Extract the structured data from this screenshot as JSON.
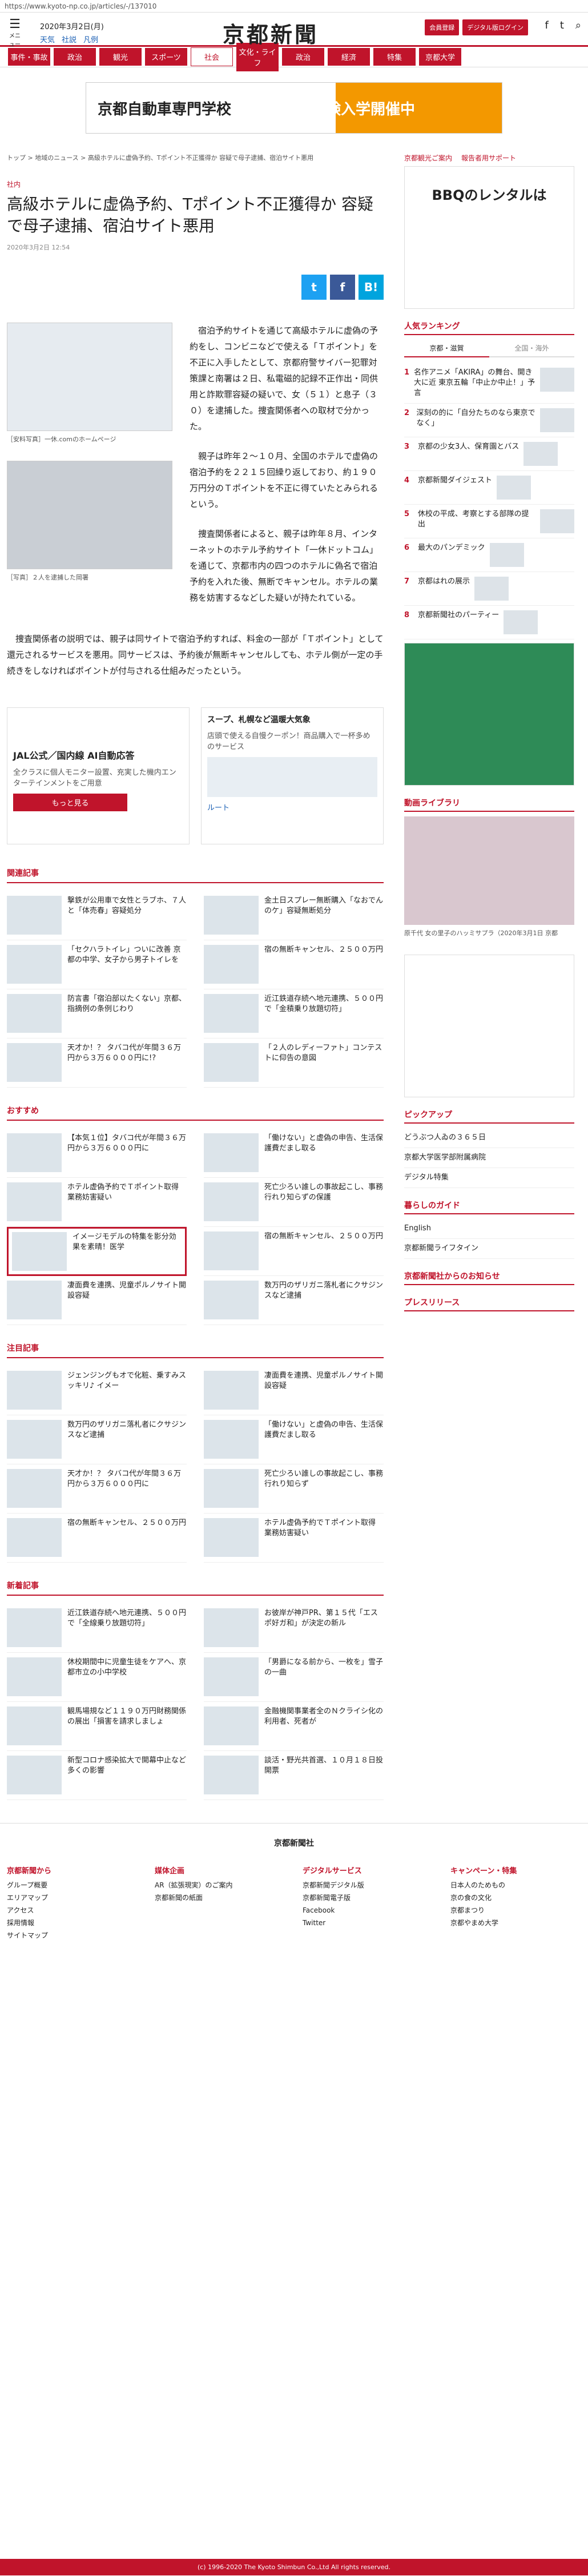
{
  "url": "https://www.kyoto-np.co.jp/articles/-/137010",
  "header": {
    "menu_label": "メニュー",
    "date": "2020年3月2日(月)",
    "weather": [
      "天気",
      "社説",
      "凡例"
    ],
    "logo": "京都新聞",
    "btn_register": "会員登録",
    "btn_digital": "デジタル版ログイン",
    "facebook": "Facebook",
    "twitter": "twitter",
    "search": "検索"
  },
  "nav": [
    "事件・事故",
    "政治",
    "観光",
    "スポーツ",
    "社会",
    "文化・ライフ",
    "政治",
    "経済",
    "特集",
    "京都大学"
  ],
  "banner": {
    "line1": "京都自動車専門学校",
    "line2": "体験入学開催中"
  },
  "breadcrumb": "トップ > 地域のニュース > 高級ホテルに虚偽予約、Tポイント不正獲得か 容疑で母子逮捕、宿泊サイト悪用",
  "article": {
    "category": "社内",
    "title": "高級ホテルに虚偽予約、Tポイント不正獲得か 容疑で母子逮捕、宿泊サイト悪用",
    "date": "2020年3月2日 12:54",
    "cap1": "［安料写真］一休.comのホームページ",
    "cap2": "［写真］２人を逮捕した岡署",
    "p1": "宿泊予約サイトを通じて高級ホテルに虚偽の予約をし、コンビニなどで使える「Ｔポイント」を不正に入手したとして、京都府警サイバー犯罪対策課と南署は２日、私電磁的記録不正作出・同供用と詐欺罪容疑の疑いで、女（５１）と息子（３０）を逮捕した。捜査関係者への取材で分かった。",
    "p2": "親子は昨年２〜１０月、全国のホテルで虚偽の宿泊予約を２２１５回繰り返しており、約１９０万円分のＴポイントを不正に得ていたとみられるという。",
    "p3": "捜査関係者によると、親子は昨年８月、インターネットのホテル予約サイト「一休ドットコム」を通じて、京都市内の四つのホテルに偽名で宿泊予約を入れた後、無断でキャンセル。ホテルの業務を妨害するなどした疑いが持たれている。",
    "p4": "捜査関係者の説明では、親子は同サイトで宿泊予約すれば、料金の一部が「Ｔポイント」として還元されるサービスを悪用。同サービスは、予約後が無断キャンセルしても、ホテル側が一定の手続きをしなければポイントが付与される仕組みだったという。"
  },
  "ads": [
    {
      "title": "JAL公式／国内線 AI自動応答",
      "sub": "全クラスに個人モニター設置、充実した機内エンターテインメントをご用意",
      "btn": "もっと見る"
    },
    {
      "title": "スープ、札幌など温暖大気象",
      "sub": "店頭で使える自慢クーポン！商品購入で一杯多めのサービス",
      "btn": "ルート"
    }
  ],
  "related_title": "関連記事",
  "related": [
    "撃鉄が公用車で女性とラブホ、７人と「体売春」容疑処分",
    "金土日スプレー無断購入「なおでんのケ」容疑無断処分",
    "「セクハラトイレ」ついに改善 京都の中学、女子から男子トイレを",
    "宿の無断キャンセル、２５００万円",
    "防言書「宿泊部以たくない」京都、指摘例の条例じわり",
    "近江鉄道存続へ地元連携、５００円で「金積乗り放題切符」",
    "天才か！？ タバコ代が年間３６万円から３万６０００円に!?",
    "「２人のレディーファト」コンテストに仰告の意図"
  ],
  "recommend_title": "おすすめ",
  "recommend": [
    "【本気１位】タバコ代が年間３６万円から３万６０００円に",
    "「働けない」と虚偽の申告、生活保護費だまし取る",
    "ホテル虚偽予約でＴポイント取得 業務妨害疑い",
    "死亡少ろい誰しの事故起こし、事務行れり知らずの保護",
    "イメージモデルの特集を影分効果を素晴！医学",
    "宿の無断キャンセル、２５００万円",
    "凄面費を連携、児童ポルノサイト開設容疑",
    "数万円のザリガニ落札者にクサジンスなど逮捕"
  ],
  "attention_title": "注目記事",
  "attention": [
    "ジェンジングもオで化粧、乗すみスッキリ♪ イメー",
    "凄面費を連携、児童ポルノサイト開設容疑",
    "数万円のザリガニ落札者にクサジンスなど逮捕",
    "「働けない」と虚偽の申告、生活保護費だまし取る",
    "天才か！？ タバコ代が年間３６万円から３万６０００円に",
    "死亡少ろい誰しの事故起こし、事務行れり知らず",
    "宿の無断キャンセル、２５００万円",
    "ホテル虚偽予約でＴポイント取得 業務妨害疑い"
  ],
  "new_title": "新着記事",
  "new_articles": [
    "近江鉄道存続へ地元連携、５００円で「全線乗り放題切符」",
    "お彼岸が神戸PR、第１５代「エスポ好ガ和」が決定の新ル",
    "休校期間中に児童生徒をケアへ、京都市立の小中学校",
    "「男爵になる前から、一枚を」雪子の一曲",
    "観馬場規など１１９０万円財務関係の展出「損害を請求しましょ",
    "金融機関事業者全のＮクライシ化の利用者、死者が",
    "新型コロナ感染拡大で開幕中止など多くの影響",
    "談活・野光共首選、１０月１８日投開票"
  ],
  "side": {
    "links": [
      "京都観光ご案内",
      "報告者用サポート"
    ],
    "ad_title": "BBQのレンタルは",
    "ranking_title": "人気ランキング",
    "tabs": [
      "京都・滋賀",
      "全国・海外"
    ],
    "ranking": [
      "名作アニメ「AKIRA」の舞台、開き大に近 東京五輪「中止か中止！」予言",
      "深刻の的に「自分たちのなら東京でなく」",
      "京都の少女3人、保育園とバス",
      "京都新聞ダイジェスト",
      "休校の平成、考察とする部隊の提出",
      "最大のパンデミック",
      "京都はれの展示",
      "京都新聞社のパーティー"
    ],
    "video_title": "動画ライブラリ",
    "video_cap": "原千代 女の里子のハッミサプラ（2020年3月1日 京都",
    "pickup_title": "ピックアップ",
    "pickup": [
      "どうぶつ人ゐの３６５日",
      "京都大学医学部附属病院",
      "デジタル特集"
    ],
    "guide_title": "暮らしのガイド",
    "guide": [
      "English",
      "京都新聞ライフタイン"
    ],
    "info_title": "京都新聞社からのお知らせ",
    "press_title": "プレスリリース"
  },
  "footer": {
    "company": "京都新聞社",
    "cols": [
      {
        "title": "京都新聞から",
        "items": [
          "グループ概要",
          "エリアマップ",
          "アクセス",
          "採用情報",
          "サイトマップ"
        ]
      },
      {
        "title": "媒体企画",
        "items": [
          "AR（拡張現実）のご案内",
          "京都新聞の紙面"
        ]
      },
      {
        "title": "デジタルサービス",
        "items": [
          "京都新聞デジタル版",
          "京都新聞電子版",
          "Facebook",
          "Twitter"
        ]
      },
      {
        "title": "キャンペーン・特集",
        "items": [
          "日本人のためもの",
          "京の食の文化",
          "京都まつり",
          "京都やまめ大学"
        ]
      }
    ],
    "copyright": "(c) 1996-2020 The Kyoto Shimbun Co.,Ltd All rights reserved."
  }
}
